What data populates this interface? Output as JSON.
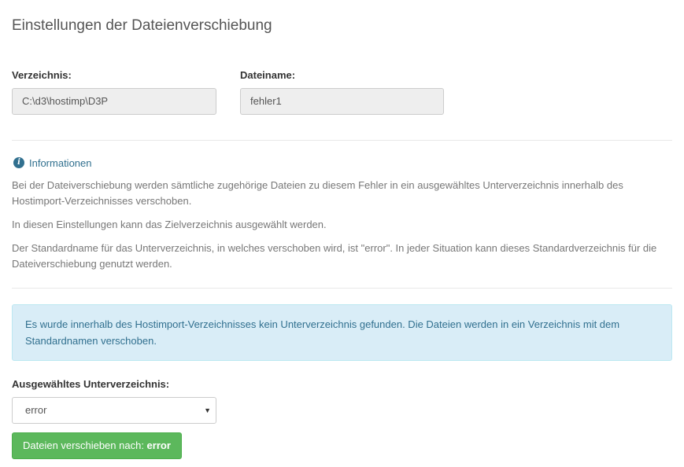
{
  "page": {
    "title": "Einstellungen der Dateienverschiebung"
  },
  "fields": {
    "directory": {
      "label": "Verzeichnis:",
      "value": "C:\\d3\\hostimp\\D3P"
    },
    "filename": {
      "label": "Dateiname:",
      "value": "fehler1"
    }
  },
  "info": {
    "icon": "info-circle-icon",
    "heading": "Informationen",
    "paragraphs": [
      "Bei der Dateiverschiebung werden sämtliche zugehörige Dateien zu diesem Fehler in ein ausgewähltes Unterverzeichnis innerhalb des Hostimport-Verzeichnisses verschoben.",
      "In diesen Einstellungen kann das Zielverzeichnis ausgewählt werden.",
      "Der Standardname für das Unterverzeichnis, in welches verschoben wird, ist \"error\". In jeder Situation kann dieses Standardverzeichnis für die Dateiverschiebung genutzt werden."
    ]
  },
  "alert": {
    "text": "Es wurde innerhalb des Hostimport-Verzeichnisses kein Unterverzeichnis gefunden. Die Dateien werden in ein Verzeichnis mit dem Standardnamen verschoben."
  },
  "subdirectory": {
    "label": "Ausgewähltes Unterverzeichnis:",
    "selected": "error",
    "arrow_icon": "caret-down-icon"
  },
  "action": {
    "label_prefix": "Dateien verschieben nach: ",
    "label_target": "error"
  },
  "colors": {
    "info_blue": "#31708f",
    "alert_background": "#d9edf7",
    "button_green": "#5cb85c"
  }
}
